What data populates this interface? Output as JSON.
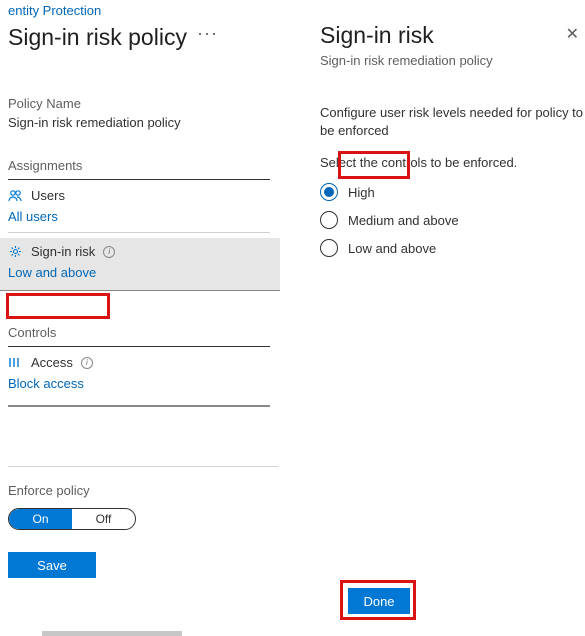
{
  "breadcrumb": "entity Protection",
  "left": {
    "title": "Sign-in risk policy",
    "policy_name_label": "Policy Name",
    "policy_name_value": "Sign-in risk remediation policy",
    "assignments_label": "Assignments",
    "users_label": "Users",
    "users_value": "All users",
    "signin_risk_label": "Sign-in risk",
    "signin_risk_value": "Low and above",
    "controls_label": "Controls",
    "access_label": "Access",
    "access_value": "Block access",
    "enforce_label": "Enforce policy",
    "toggle_on": "On",
    "toggle_off": "Off",
    "save": "Save"
  },
  "right": {
    "title": "Sign-in risk",
    "subtitle": "Sign-in risk remediation policy",
    "description": "Configure user risk levels needed for policy to be enforced",
    "select_label": "Select the controls to be enforced.",
    "options": {
      "high": "High",
      "medium": "Medium and above",
      "low": "Low and above"
    },
    "selected": "high",
    "done": "Done"
  }
}
